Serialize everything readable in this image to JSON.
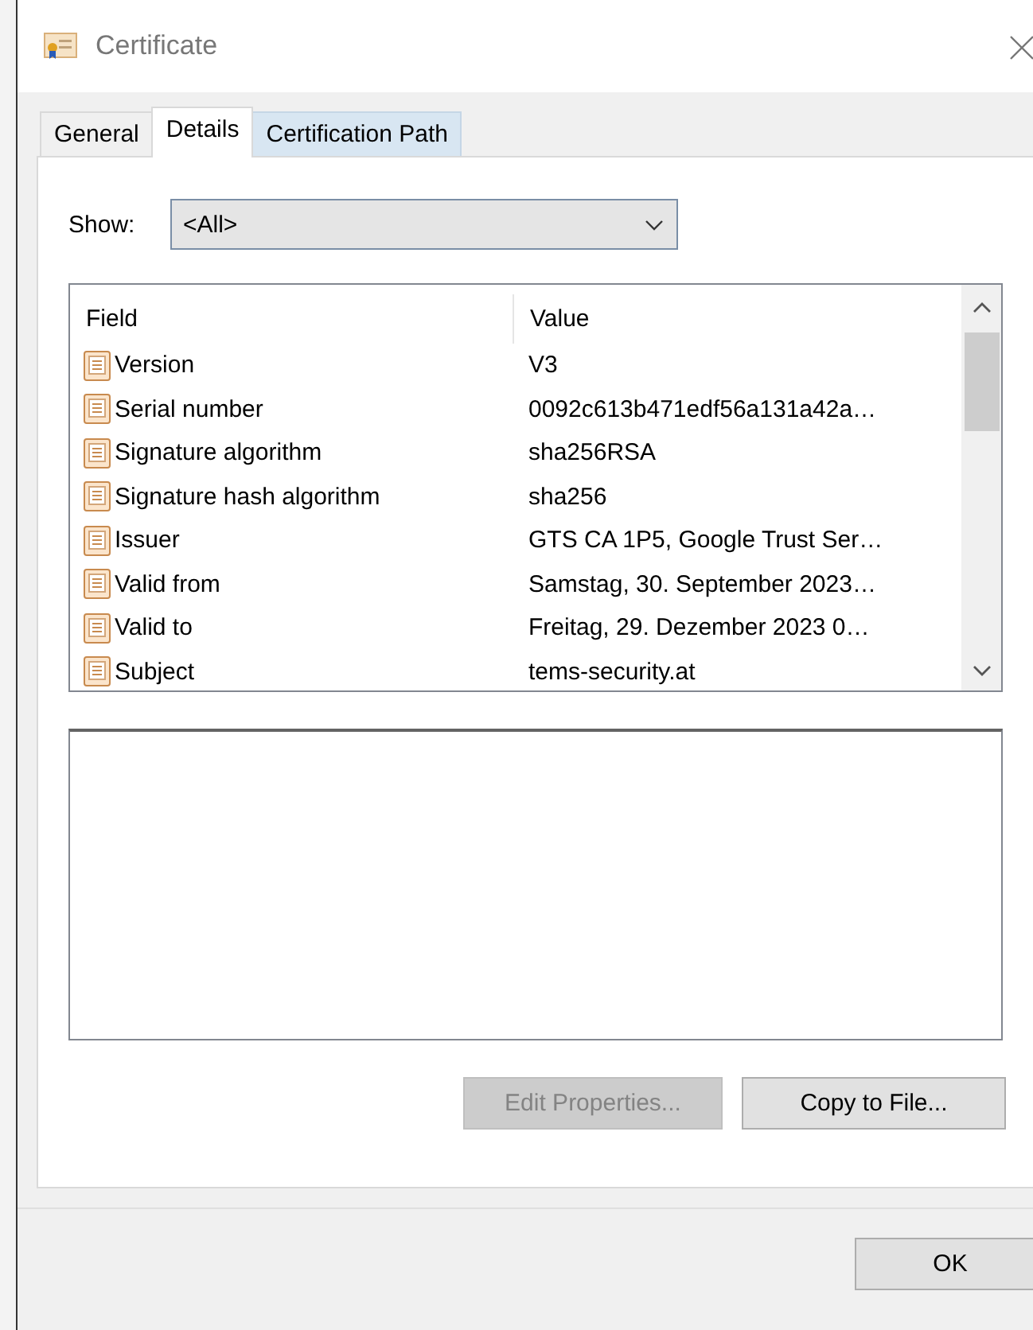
{
  "window": {
    "title": "Certificate"
  },
  "tabs": [
    {
      "label": "General",
      "selected": false,
      "hovered": false
    },
    {
      "label": "Details",
      "selected": true,
      "hovered": false
    },
    {
      "label": "Certification Path",
      "selected": false,
      "hovered": true
    }
  ],
  "show": {
    "label": "Show:",
    "value": "<All>"
  },
  "table": {
    "columns": [
      "Field",
      "Value"
    ],
    "rows": [
      {
        "field": "Version",
        "value": "V3"
      },
      {
        "field": "Serial number",
        "value": "0092c613b471edf56a131a42a…"
      },
      {
        "field": "Signature algorithm",
        "value": "sha256RSA"
      },
      {
        "field": "Signature hash algorithm",
        "value": "sha256"
      },
      {
        "field": "Issuer",
        "value": "GTS CA 1P5, Google Trust Ser…"
      },
      {
        "field": "Valid from",
        "value": "Samstag, 30. September 2023…"
      },
      {
        "field": "Valid to",
        "value": "Freitag, 29. Dezember 2023 0…"
      },
      {
        "field": "Subject",
        "value": "tems-security.at"
      }
    ]
  },
  "buttons": [
    {
      "label": "Edit Properties...",
      "disabled": true
    },
    {
      "label": "Copy to File...",
      "disabled": false
    }
  ],
  "footer_buttons": [
    {
      "label": "OK",
      "disabled": false
    }
  ]
}
